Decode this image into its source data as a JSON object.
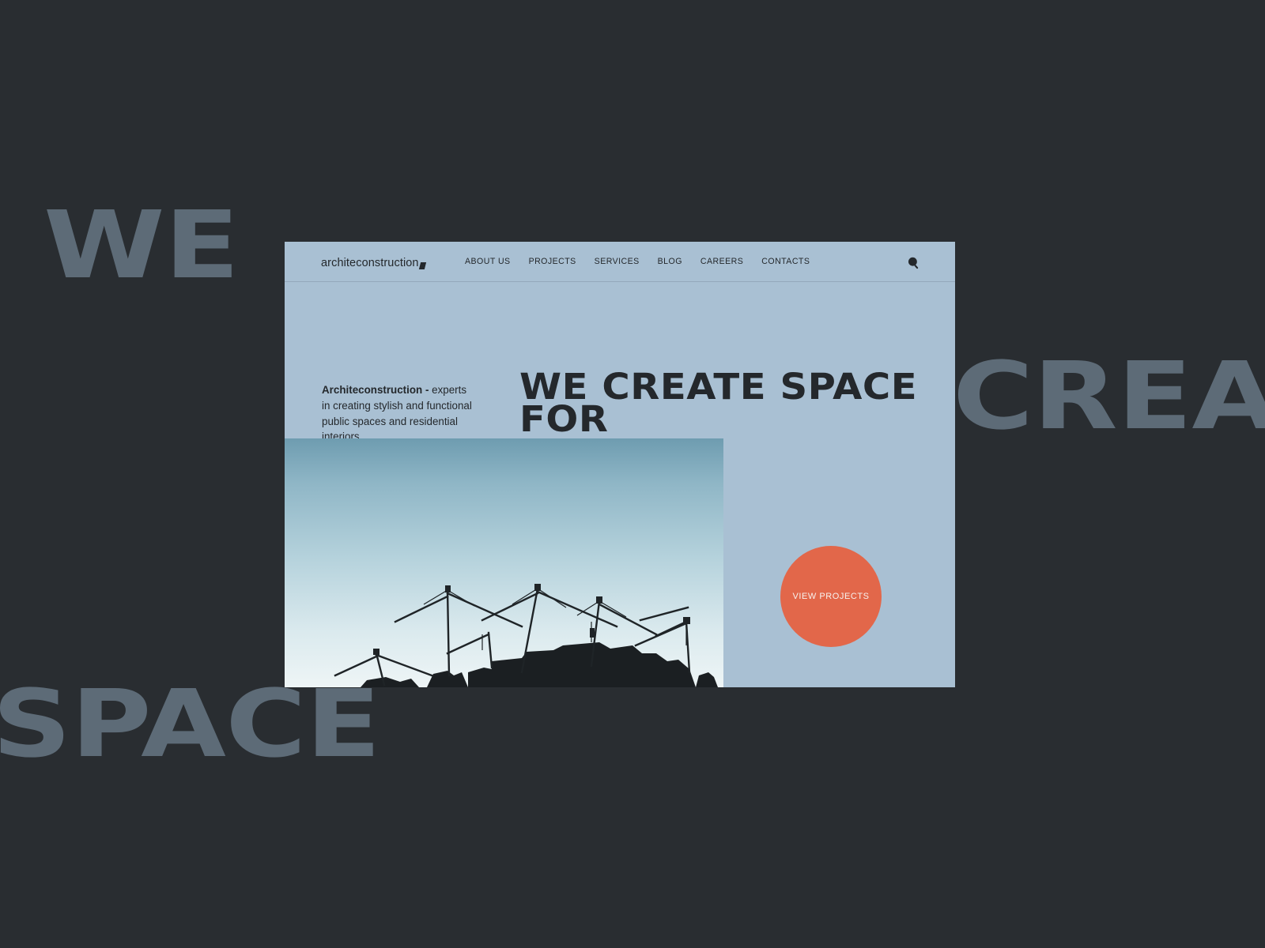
{
  "backdrop": {
    "color": "#292d31",
    "ghost_words": [
      {
        "text": "WE",
        "color": "#5d6b77"
      },
      {
        "text": "CREAT",
        "color": "#5d6b77"
      },
      {
        "text": "SPACE",
        "color": "#5d6b77"
      }
    ]
  },
  "site": {
    "background_color": "#a9c0d3",
    "accent_color": "#e2674a",
    "text_color": "#24282c",
    "header": {
      "logo": "architeconstruction",
      "nav": [
        {
          "label": "ABOUT US"
        },
        {
          "label": "PROJECTS"
        },
        {
          "label": "SERVICES"
        },
        {
          "label": "BLOG"
        },
        {
          "label": "CAREERS"
        },
        {
          "label": "CONTACTS"
        }
      ],
      "search_icon": "search-icon"
    },
    "hero": {
      "intro_strong": "Architeconstruction -",
      "intro_rest": " experts in creating stylish and functional public spaces and residential interiors.",
      "heading": "WE CREATE SPACE\nFOR",
      "photo_alt": "construction-site-cranes",
      "cta_label": "VIEW PROJECTS"
    }
  }
}
